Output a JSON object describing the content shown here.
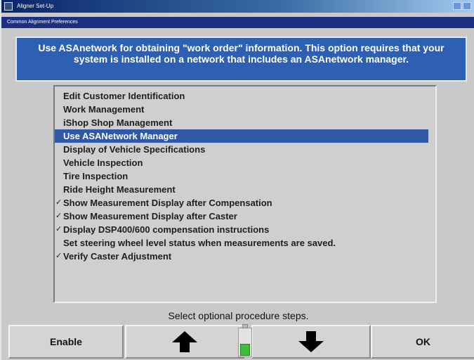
{
  "window": {
    "title": "Aligner Set-Up",
    "subtitle": "Common Alignment Preferences"
  },
  "info": {
    "text": "Use ASAnetwork for obtaining \"work order\" information.  This option requires that your system is installed on a network that includes an ASAnetwork manager."
  },
  "list": {
    "items": [
      {
        "label": "Edit Customer Identification",
        "checked": false,
        "selected": false
      },
      {
        "label": "Work Management",
        "checked": false,
        "selected": false
      },
      {
        "label": "iShop Shop Management",
        "checked": false,
        "selected": false
      },
      {
        "label": "Use ASANetwork Manager",
        "checked": false,
        "selected": true
      },
      {
        "label": "Display of Vehicle Specifications",
        "checked": false,
        "selected": false
      },
      {
        "label": "Vehicle Inspection",
        "checked": false,
        "selected": false
      },
      {
        "label": "Tire Inspection",
        "checked": false,
        "selected": false
      },
      {
        "label": "Ride Height Measurement",
        "checked": false,
        "selected": false
      },
      {
        "label": "Show Measurement Display after Compensation",
        "checked": true,
        "selected": false
      },
      {
        "label": "Show Measurement Display after Caster",
        "checked": true,
        "selected": false
      },
      {
        "label": "Display DSP400/600 compensation instructions",
        "checked": true,
        "selected": false
      },
      {
        "label": "Set steering wheel level status when measurements are saved.",
        "checked": false,
        "selected": false
      },
      {
        "label": "Verify Caster Adjustment",
        "checked": true,
        "selected": false
      }
    ],
    "check_glyph": "✓"
  },
  "prompt": "Select optional procedure steps.",
  "buttons": {
    "enable_label": "Enable",
    "up_icon": "arrow-up-icon",
    "down_icon": "arrow-down-icon",
    "ok_label": "OK"
  },
  "gauge": {
    "level": 0.45,
    "color": "#3dbd3d"
  },
  "colors": {
    "selection": "#2f59a8",
    "info_background": "#2d5fb5"
  }
}
